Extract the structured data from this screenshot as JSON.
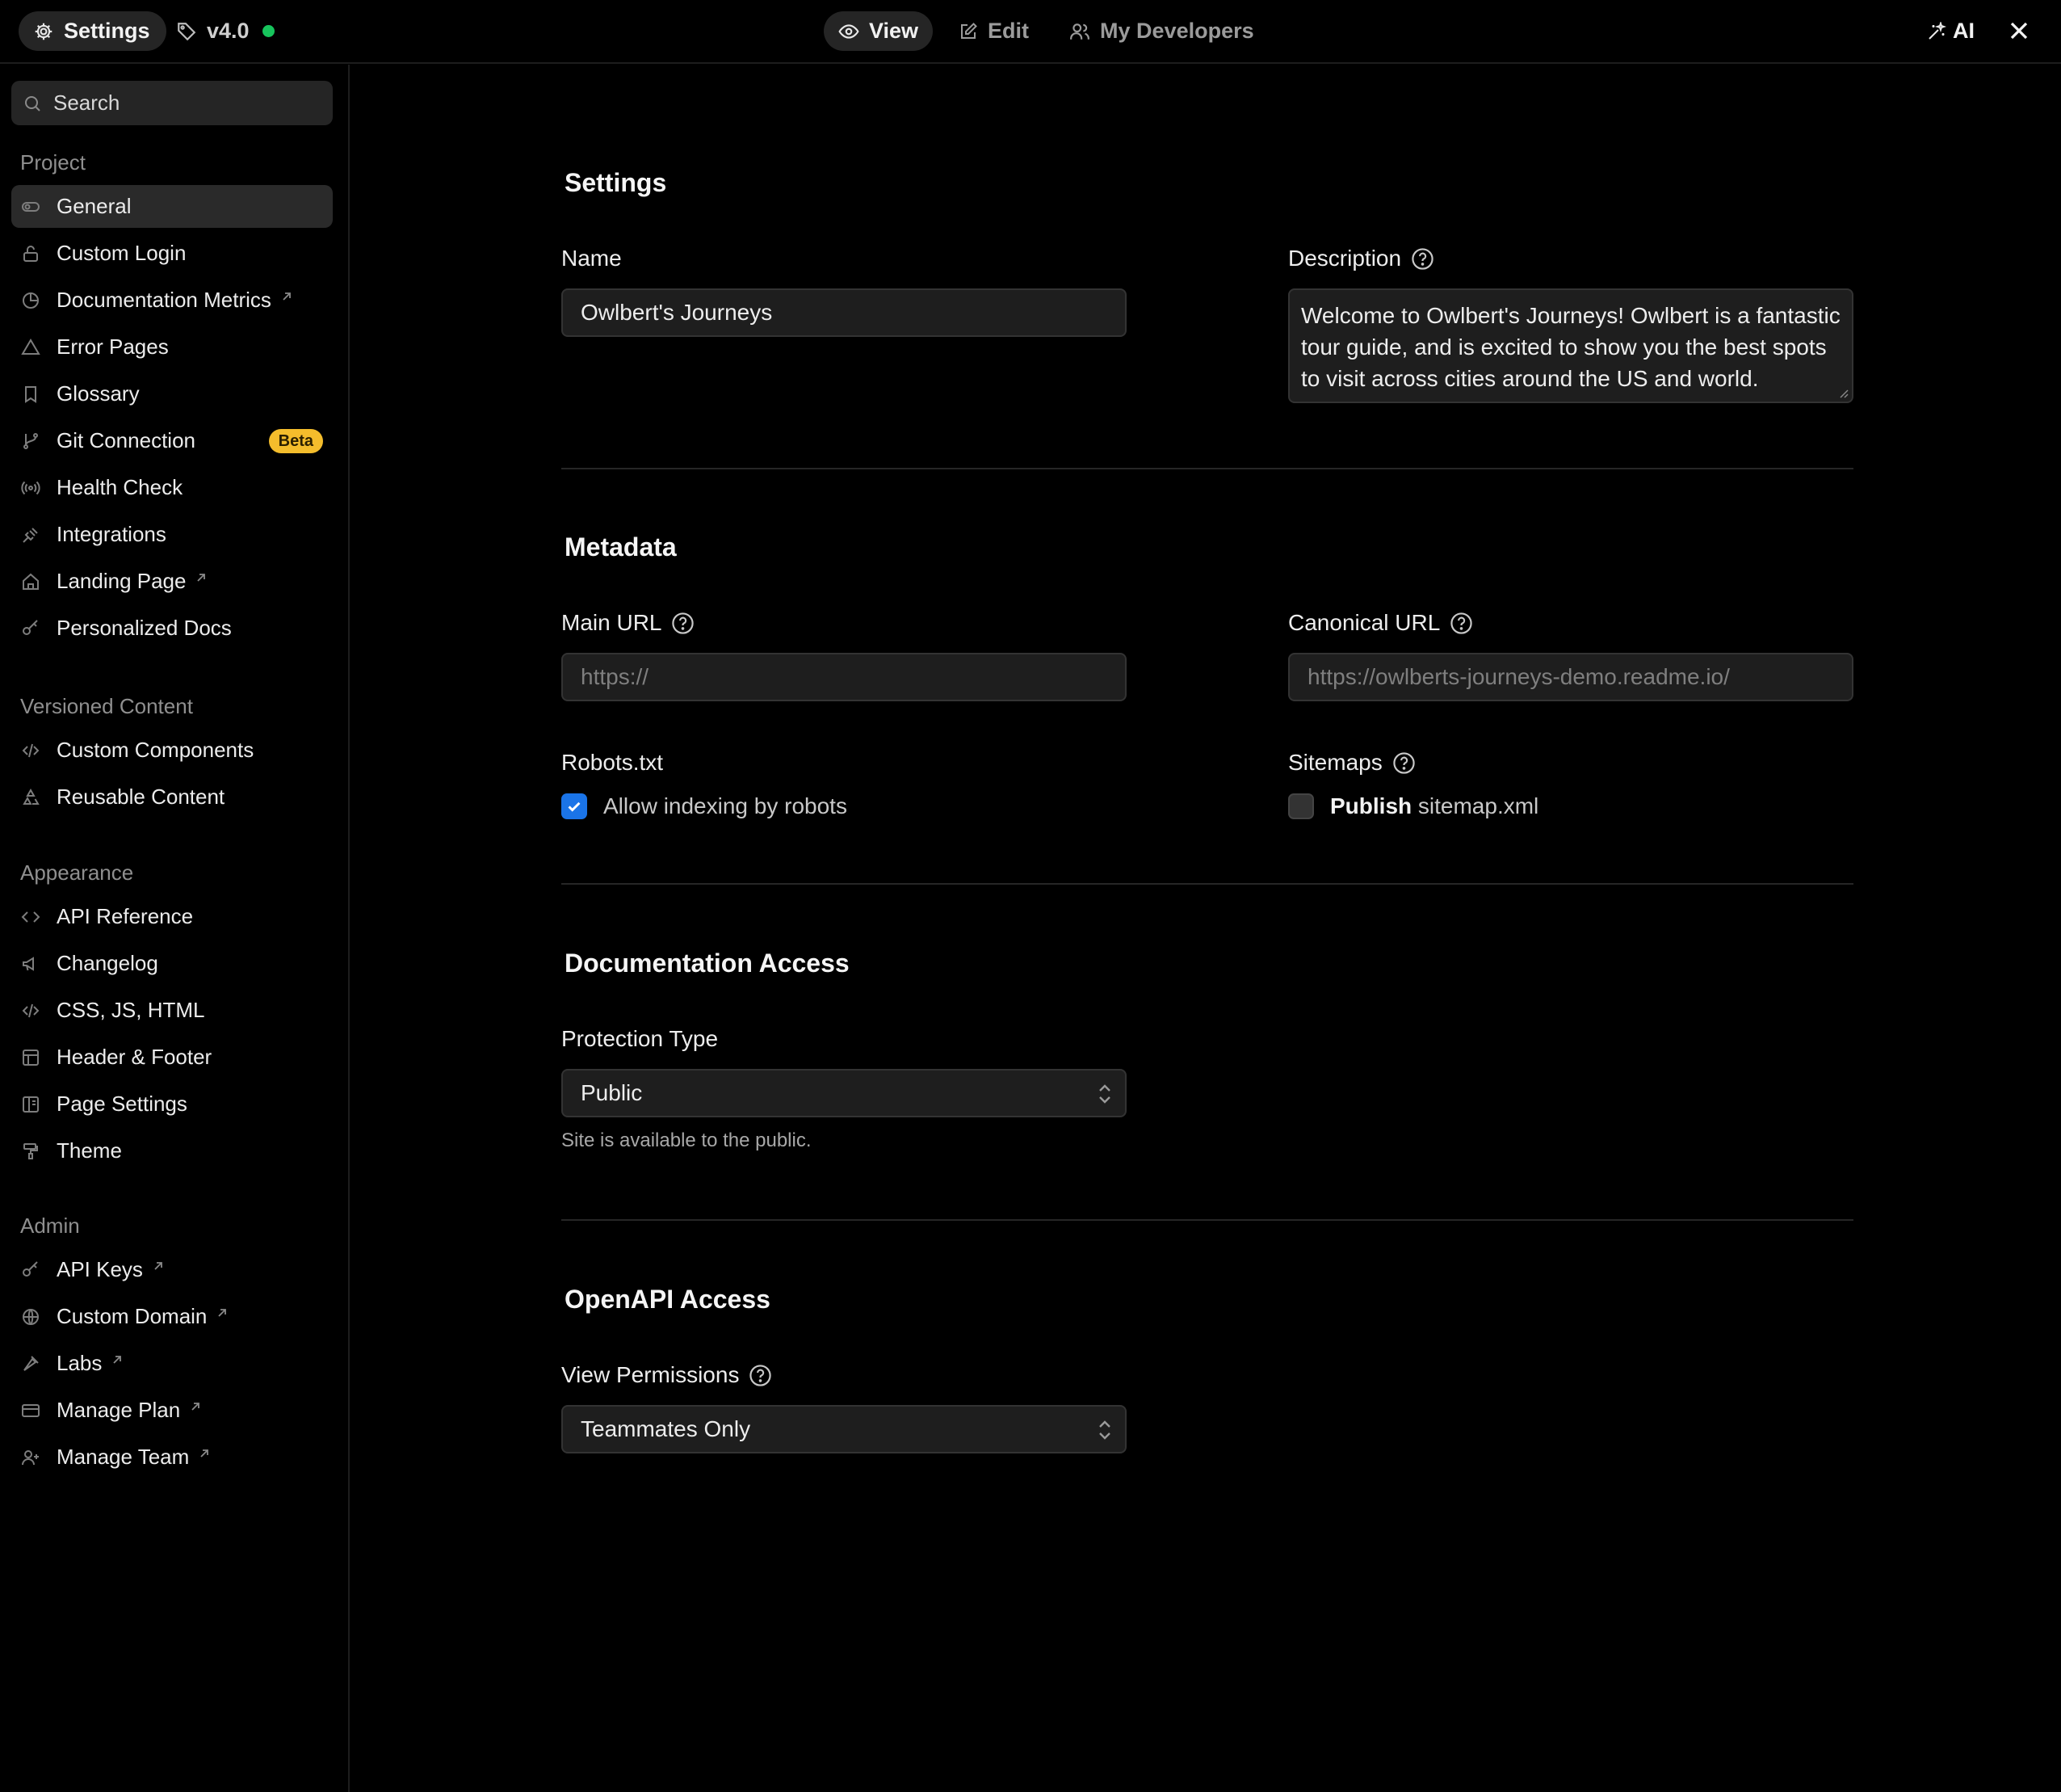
{
  "topbar": {
    "settings_label": "Settings",
    "version_label": "v4.0",
    "status_color": "#17c45c",
    "modes": [
      {
        "label": "View",
        "icon": "eye-icon",
        "active": true
      },
      {
        "label": "Edit",
        "icon": "edit-icon",
        "active": false
      },
      {
        "label": "My Developers",
        "icon": "users-icon",
        "active": false
      }
    ],
    "ai_label": "AI"
  },
  "sidebar": {
    "search_label": "Search",
    "groups": [
      {
        "title": "Project",
        "items": [
          {
            "label": "General",
            "icon": "toggle-icon",
            "active": true
          },
          {
            "label": "Custom Login",
            "icon": "lock-icon"
          },
          {
            "label": "Documentation Metrics",
            "icon": "pie-chart-icon",
            "external": true
          },
          {
            "label": "Error Pages",
            "icon": "warning-icon"
          },
          {
            "label": "Glossary",
            "icon": "bookmark-icon"
          },
          {
            "label": "Git Connection",
            "icon": "git-branch-icon",
            "badge": "Beta"
          },
          {
            "label": "Health Check",
            "icon": "broadcast-icon"
          },
          {
            "label": "Integrations",
            "icon": "plug-icon"
          },
          {
            "label": "Landing Page",
            "icon": "home-icon",
            "external": true
          },
          {
            "label": "Personalized Docs",
            "icon": "key-icon"
          }
        ]
      },
      {
        "title": "Versioned Content",
        "items": [
          {
            "label": "Custom Components",
            "icon": "code-icon"
          },
          {
            "label": "Reusable Content",
            "icon": "recycle-icon"
          }
        ]
      },
      {
        "title": "Appearance",
        "items": [
          {
            "label": "API Reference",
            "icon": "brackets-icon"
          },
          {
            "label": "Changelog",
            "icon": "megaphone-icon"
          },
          {
            "label": "CSS, JS, HTML",
            "icon": "code-icon"
          },
          {
            "label": "Header & Footer",
            "icon": "layout-icon"
          },
          {
            "label": "Page Settings",
            "icon": "columns-icon"
          },
          {
            "label": "Theme",
            "icon": "paint-roller-icon"
          }
        ]
      },
      {
        "title": "Admin",
        "items": [
          {
            "label": "API Keys",
            "icon": "key-icon",
            "external": true
          },
          {
            "label": "Custom Domain",
            "icon": "globe-icon",
            "external": true
          },
          {
            "label": "Labs",
            "icon": "flask-icon",
            "external": true
          },
          {
            "label": "Manage Plan",
            "icon": "credit-card-icon",
            "external": true
          },
          {
            "label": "Manage Team",
            "icon": "user-plus-icon",
            "external": true
          }
        ]
      }
    ]
  },
  "settings": {
    "title": "Settings",
    "name_label": "Name",
    "name_value": "Owlbert's Journeys",
    "description_label": "Description",
    "description_value": "Welcome to Owlbert's Journeys! Owlbert is a fantastic tour guide, and is excited to show you the best spots to visit across cities around the US and world."
  },
  "metadata": {
    "title": "Metadata",
    "main_url_label": "Main URL",
    "main_url_placeholder": "https://",
    "canonical_url_label": "Canonical URL",
    "canonical_url_placeholder": "https://owlberts-journeys-demo.readme.io/",
    "robots_label": "Robots.txt",
    "robots_checkbox_label": "Allow indexing by robots",
    "robots_checked": true,
    "sitemaps_label": "Sitemaps",
    "sitemaps_bold": "Publish",
    "sitemaps_text": "sitemap.xml",
    "sitemaps_checked": false
  },
  "doc_access": {
    "title": "Documentation Access",
    "protection_label": "Protection Type",
    "protection_value": "Public",
    "protection_help": "Site is available to the public."
  },
  "openapi_access": {
    "title": "OpenAPI Access",
    "permissions_label": "View Permissions",
    "permissions_value": "Teammates Only"
  }
}
